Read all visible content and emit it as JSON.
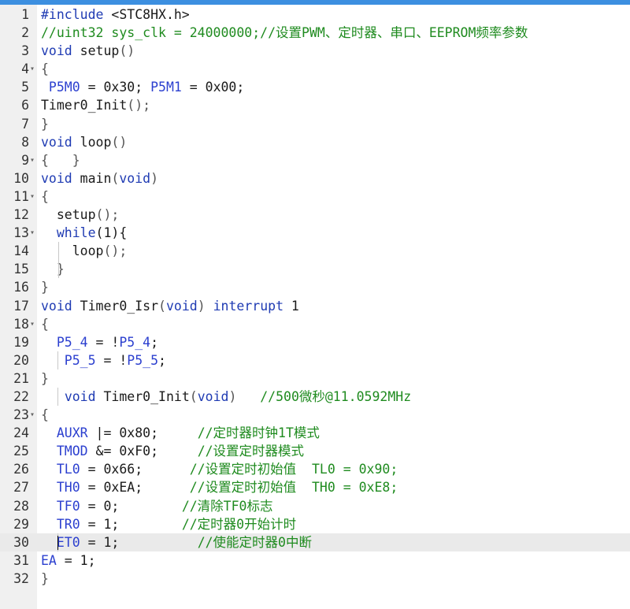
{
  "editor": {
    "colors": {
      "keyword": "#1f3bb3",
      "comment": "#1f8b1f",
      "identifier": "#2b3fcf",
      "plain": "#1a1a1a",
      "paren": "#555555",
      "gutter": "#f0f0f0",
      "active_line": "#eaeaea"
    },
    "active_line": 30,
    "lines": [
      {
        "n": "1",
        "fold": false,
        "tokens": [
          {
            "t": "#include ",
            "c": "keyword"
          },
          {
            "t": "<STC8HX.h>",
            "c": "plain"
          }
        ]
      },
      {
        "n": "2",
        "fold": false,
        "tokens": [
          {
            "t": "//uint32 sys_clk = 24000000;//设置PWM、定时器、串口、EEPROM频率参数",
            "c": "comment"
          }
        ]
      },
      {
        "n": "3",
        "fold": false,
        "tokens": [
          {
            "t": "void",
            "c": "keyword"
          },
          {
            "t": " setup",
            "c": "plain"
          },
          {
            "t": "()",
            "c": "paren"
          }
        ]
      },
      {
        "n": "4",
        "fold": true,
        "tokens": [
          {
            "t": "{",
            "c": "paren"
          }
        ]
      },
      {
        "n": "5",
        "fold": false,
        "tokens": [
          {
            "t": " P5M0",
            "c": "identifier"
          },
          {
            "t": " = 0x30; ",
            "c": "plain"
          },
          {
            "t": "P5M1",
            "c": "identifier"
          },
          {
            "t": " = 0x00;",
            "c": "plain"
          }
        ]
      },
      {
        "n": "6",
        "fold": false,
        "tokens": [
          {
            "t": "Timer0_Init",
            "c": "plain"
          },
          {
            "t": "();",
            "c": "paren"
          }
        ]
      },
      {
        "n": "7",
        "fold": false,
        "tokens": [
          {
            "t": "}",
            "c": "paren"
          }
        ]
      },
      {
        "n": "8",
        "fold": false,
        "tokens": [
          {
            "t": "void",
            "c": "keyword"
          },
          {
            "t": " loop",
            "c": "plain"
          },
          {
            "t": "()",
            "c": "paren"
          }
        ]
      },
      {
        "n": "9",
        "fold": true,
        "tokens": [
          {
            "t": "{   }",
            "c": "paren"
          }
        ]
      },
      {
        "n": "10",
        "fold": false,
        "tokens": [
          {
            "t": "void",
            "c": "keyword"
          },
          {
            "t": " main",
            "c": "plain"
          },
          {
            "t": "(",
            "c": "paren"
          },
          {
            "t": "void",
            "c": "keyword"
          },
          {
            "t": ")",
            "c": "paren"
          }
        ]
      },
      {
        "n": "11",
        "fold": true,
        "tokens": [
          {
            "t": "{",
            "c": "paren"
          }
        ]
      },
      {
        "n": "12",
        "fold": false,
        "tokens": [
          {
            "t": "  setup",
            "c": "plain"
          },
          {
            "t": "();",
            "c": "paren"
          }
        ]
      },
      {
        "n": "13",
        "fold": true,
        "tokens": [
          {
            "t": "  ",
            "c": "plain"
          },
          {
            "t": "while",
            "c": "keyword"
          },
          {
            "t": "(1){",
            "c": "plain"
          }
        ]
      },
      {
        "n": "14",
        "fold": false,
        "tokens": [
          {
            "t": "    loop",
            "c": "plain"
          },
          {
            "t": "();",
            "c": "paren"
          }
        ]
      },
      {
        "n": "15",
        "fold": false,
        "tokens": [
          {
            "t": "  }",
            "c": "paren"
          }
        ]
      },
      {
        "n": "16",
        "fold": false,
        "tokens": [
          {
            "t": "}",
            "c": "paren"
          }
        ]
      },
      {
        "n": "17",
        "fold": false,
        "tokens": [
          {
            "t": "void",
            "c": "keyword"
          },
          {
            "t": " Timer0_Isr",
            "c": "plain"
          },
          {
            "t": "(",
            "c": "paren"
          },
          {
            "t": "void",
            "c": "keyword"
          },
          {
            "t": ") ",
            "c": "paren"
          },
          {
            "t": "interrupt",
            "c": "keyword"
          },
          {
            "t": " 1",
            "c": "plain"
          }
        ]
      },
      {
        "n": "18",
        "fold": true,
        "tokens": [
          {
            "t": "{",
            "c": "paren"
          }
        ]
      },
      {
        "n": "19",
        "fold": false,
        "tokens": [
          {
            "t": "  P5_4",
            "c": "identifier"
          },
          {
            "t": " = !",
            "c": "plain"
          },
          {
            "t": "P5_4",
            "c": "identifier"
          },
          {
            "t": ";",
            "c": "plain"
          }
        ]
      },
      {
        "n": "20",
        "fold": false,
        "tokens": [
          {
            "t": "   P5_5",
            "c": "identifier"
          },
          {
            "t": " = !",
            "c": "plain"
          },
          {
            "t": "P5_5",
            "c": "identifier"
          },
          {
            "t": ";",
            "c": "plain"
          }
        ]
      },
      {
        "n": "21",
        "fold": false,
        "tokens": [
          {
            "t": "}",
            "c": "paren"
          }
        ]
      },
      {
        "n": "22",
        "fold": false,
        "tokens": [
          {
            "t": "   ",
            "c": "plain"
          },
          {
            "t": "void",
            "c": "keyword"
          },
          {
            "t": " Timer0_Init",
            "c": "plain"
          },
          {
            "t": "(",
            "c": "paren"
          },
          {
            "t": "void",
            "c": "keyword"
          },
          {
            "t": ")",
            "c": "paren"
          },
          {
            "t": "   //500微秒@11.0592MHz",
            "c": "comment"
          }
        ]
      },
      {
        "n": "23",
        "fold": true,
        "tokens": [
          {
            "t": "{",
            "c": "paren"
          }
        ]
      },
      {
        "n": "24",
        "fold": false,
        "tokens": [
          {
            "t": "  AUXR",
            "c": "identifier"
          },
          {
            "t": " |= 0x80;     ",
            "c": "plain"
          },
          {
            "t": "//定时器时钟1T模式",
            "c": "comment"
          }
        ]
      },
      {
        "n": "25",
        "fold": false,
        "tokens": [
          {
            "t": "  TMOD",
            "c": "identifier"
          },
          {
            "t": " &= 0xF0;     ",
            "c": "plain"
          },
          {
            "t": "//设置定时器模式",
            "c": "comment"
          }
        ]
      },
      {
        "n": "26",
        "fold": false,
        "tokens": [
          {
            "t": "  TL0",
            "c": "identifier"
          },
          {
            "t": " = 0x66;      ",
            "c": "plain"
          },
          {
            "t": "//设置定时初始值  TL0 = 0x90;",
            "c": "comment"
          }
        ]
      },
      {
        "n": "27",
        "fold": false,
        "tokens": [
          {
            "t": "  TH0",
            "c": "identifier"
          },
          {
            "t": " = 0xEA;      ",
            "c": "plain"
          },
          {
            "t": "//设置定时初始值  TH0 = 0xE8;",
            "c": "comment"
          }
        ]
      },
      {
        "n": "28",
        "fold": false,
        "tokens": [
          {
            "t": "  TF0",
            "c": "identifier"
          },
          {
            "t": " = 0;        ",
            "c": "plain"
          },
          {
            "t": "//清除TF0标志",
            "c": "comment"
          }
        ]
      },
      {
        "n": "29",
        "fold": false,
        "tokens": [
          {
            "t": "  TR0",
            "c": "identifier"
          },
          {
            "t": " = 1;        ",
            "c": "plain"
          },
          {
            "t": "//定时器0开始计时",
            "c": "comment"
          }
        ]
      },
      {
        "n": "30",
        "fold": false,
        "tokens": [
          {
            "t": "  ET0",
            "c": "identifier"
          },
          {
            "t": " = 1;          ",
            "c": "plain"
          },
          {
            "t": "//使能定时器0中断",
            "c": "comment"
          }
        ]
      },
      {
        "n": "31",
        "fold": false,
        "tokens": [
          {
            "t": "EA",
            "c": "identifier"
          },
          {
            "t": " = 1;",
            "c": "plain"
          }
        ]
      },
      {
        "n": "32",
        "fold": false,
        "tokens": [
          {
            "t": "}",
            "c": "paren"
          }
        ]
      }
    ]
  }
}
